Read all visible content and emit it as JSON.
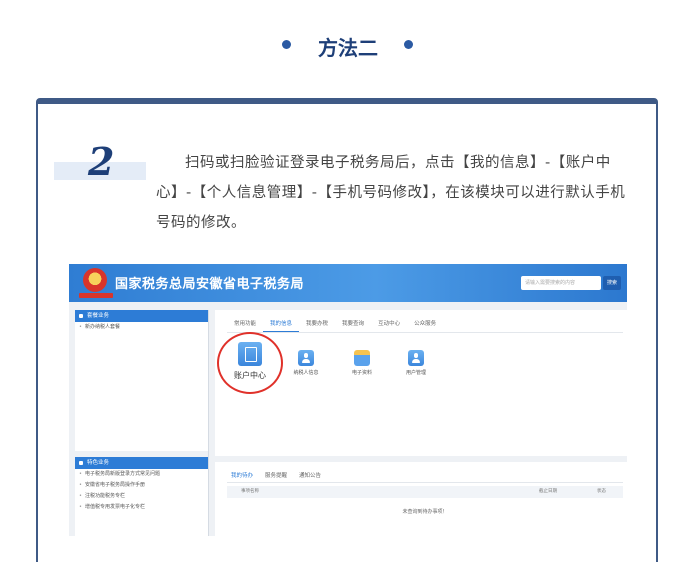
{
  "header": {
    "title": "方法二"
  },
  "step": {
    "number": "2",
    "text": "扫码或扫脸验证登录电子税务局后，点击【我的信息】-【账户中心】-【个人信息管理】-【手机号码修改】，在该模块可以进行默认手机号码的修改。"
  },
  "screenshot": {
    "site_title": "国家税务总局安徽省电子税务局",
    "emblem_caption": "国家税务总局",
    "search_placeholder": "请输入需要搜索的内容",
    "search_button": "搜索",
    "sidebar": {
      "section1_title": "套餐业务",
      "section1_items": [
        "新办纳税人套餐"
      ],
      "section2_title": "特色业务",
      "section2_items": [
        "电子税务局新版登录方式常见问题",
        "安徽省电子税务局操作手册",
        "注税功能税务专栏",
        "增值税专用发票电子化专栏"
      ]
    },
    "tabs": [
      "常用功能",
      "我的信息",
      "我要办税",
      "我要查询",
      "互动中心",
      "公众服务"
    ],
    "active_tab": "我的信息",
    "apps": [
      {
        "label": "账户中心",
        "icon": "document-user-icon"
      },
      {
        "label": "纳税人信息",
        "icon": "user-icon"
      },
      {
        "label": "电子资料",
        "icon": "stack-icon"
      },
      {
        "label": "用户管理",
        "icon": "users-icon"
      }
    ],
    "bottom_tabs": [
      "我的待办",
      "服务提醒",
      "通知公告"
    ],
    "table_headers": [
      "事项名称",
      "截止日期",
      "状态"
    ],
    "empty_text": "未查询到待办事项！"
  },
  "colors": {
    "brand": "#1e3f78",
    "accent": "#2d7cd6",
    "highlight": "#e0312a"
  }
}
